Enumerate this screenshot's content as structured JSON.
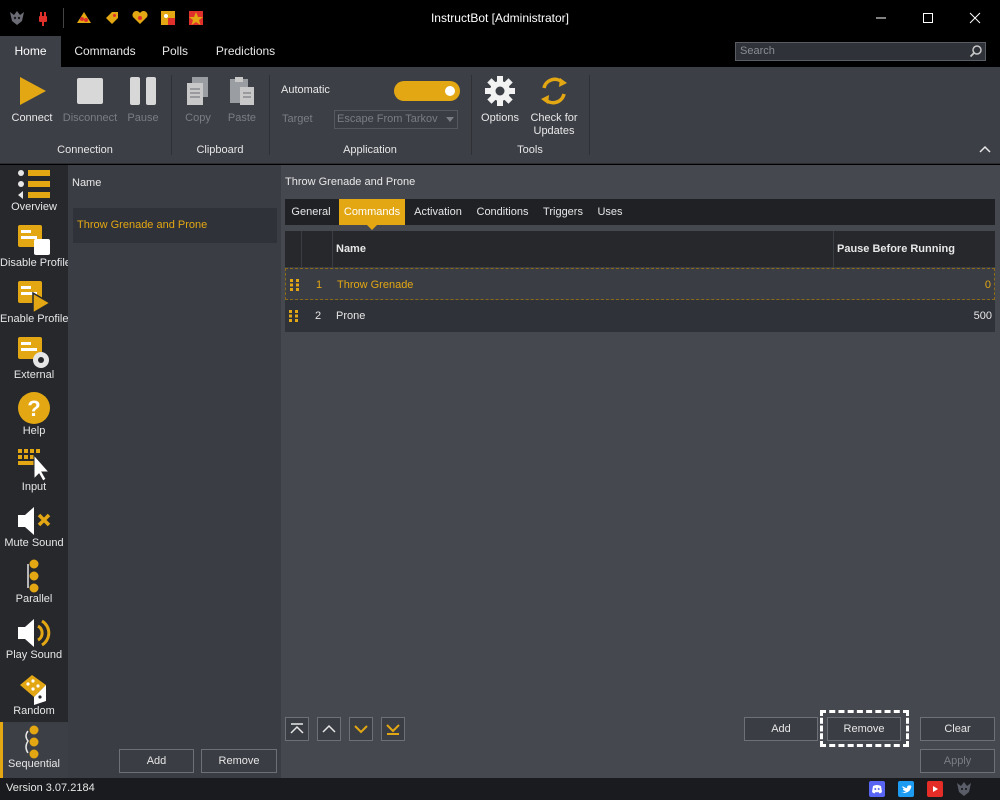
{
  "window": {
    "title": "InstructBot [Administrator]",
    "minimize_icon": "minimize-icon",
    "maximize_icon": "maximize-icon",
    "close_icon": "close-icon"
  },
  "menu": {
    "tabs": [
      {
        "label": "Home",
        "active": true
      },
      {
        "label": "Commands",
        "active": false
      },
      {
        "label": "Polls",
        "active": false
      },
      {
        "label": "Predictions",
        "active": false
      }
    ],
    "search_placeholder": "Search"
  },
  "ribbon": {
    "connection": {
      "label": "Connection",
      "connect": "Connect",
      "disconnect": "Disconnect",
      "pause": "Pause"
    },
    "clipboard": {
      "label": "Clipboard",
      "copy": "Copy",
      "paste": "Paste"
    },
    "application": {
      "label": "Application",
      "automatic_label": "Automatic",
      "automatic_on": true,
      "target_label": "Target",
      "target_value": "Escape From Tarkov"
    },
    "tools": {
      "label": "Tools",
      "options": "Options",
      "check_updates_line1": "Check for",
      "check_updates_line2": "Updates"
    }
  },
  "leftnav": {
    "items": [
      {
        "label": "Overview"
      },
      {
        "label": "Disable Profile"
      },
      {
        "label": "Enable Profile"
      },
      {
        "label": "External"
      },
      {
        "label": "Help"
      },
      {
        "label": "Input"
      },
      {
        "label": "Mute Sound"
      },
      {
        "label": "Parallel"
      },
      {
        "label": "Play Sound"
      },
      {
        "label": "Random"
      },
      {
        "label": "Sequential",
        "selected": true
      }
    ]
  },
  "list": {
    "header": "Name",
    "items": [
      "Throw Grenade and Prone"
    ],
    "add": "Add",
    "remove": "Remove"
  },
  "detail": {
    "title": "Throw Grenade and Prone",
    "tabs": [
      {
        "label": "General"
      },
      {
        "label": "Commands",
        "active": true
      },
      {
        "label": "Activation"
      },
      {
        "label": "Conditions"
      },
      {
        "label": "Triggers"
      },
      {
        "label": "Uses"
      }
    ],
    "columns": [
      "Name",
      "Pause Before Running"
    ],
    "rows": [
      {
        "num": "1",
        "name": "Throw Grenade",
        "pause": "0"
      },
      {
        "num": "2",
        "name": "Prone",
        "pause": "500"
      }
    ],
    "add": "Add",
    "remove": "Remove",
    "clear": "Clear",
    "apply": "Apply"
  },
  "status": {
    "version": "Version 3.07.2184"
  },
  "colors": {
    "accent": "#e3a713",
    "background": "#45484f",
    "dark": "#26282c"
  }
}
